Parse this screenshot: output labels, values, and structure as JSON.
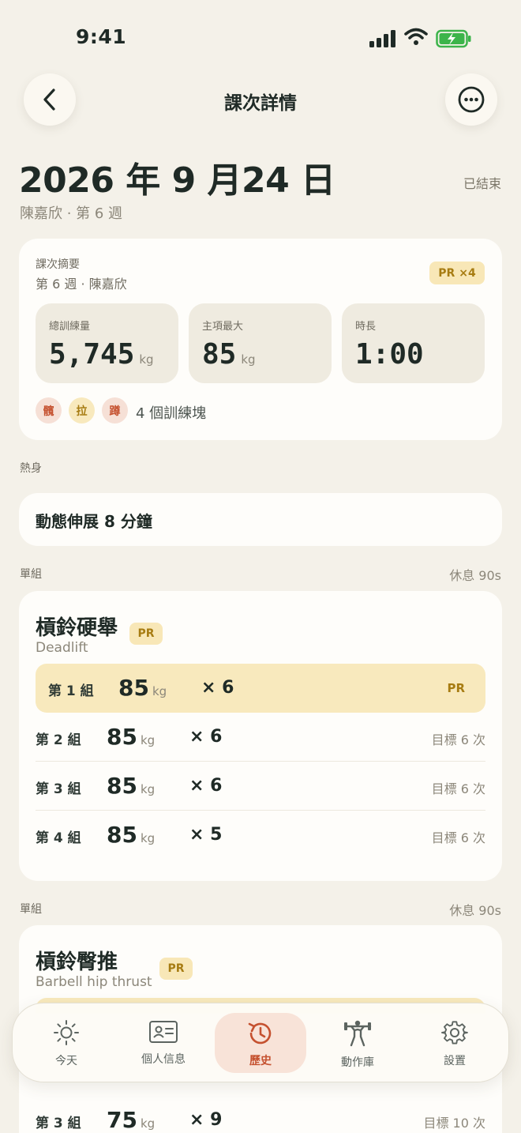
{
  "status_bar": {
    "time": "9:41"
  },
  "header": {
    "title": "課次詳情"
  },
  "session": {
    "date": "2026 年 9 月24 日",
    "status": "已結束",
    "subtitle": "陳嘉欣 · 第 6 週"
  },
  "summary": {
    "label": "課次摘要",
    "sub": "第 6 週 · 陳嘉欣",
    "pr_badge": "PR ×4",
    "stats": [
      {
        "label": "總訓練量",
        "value": "5,745",
        "unit": "kg"
      },
      {
        "label": "主項最大",
        "value": "85",
        "unit": "kg"
      },
      {
        "label": "時長",
        "value": "1:00",
        "unit": ""
      }
    ],
    "tags": [
      {
        "text": "髖",
        "bg": "#f6e0d6",
        "fg": "#c5512f"
      },
      {
        "text": "拉",
        "bg": "#f8e9bd",
        "fg": "#a77c12"
      },
      {
        "text": "蹲",
        "bg": "#f6e0d6",
        "fg": "#c5512f"
      }
    ],
    "tags_text": "4 個訓練塊"
  },
  "warmup": {
    "label": "熱身",
    "text": "動態伸展 8 分鐘"
  },
  "blocks": [
    {
      "type_label": "單組",
      "rest": "休息 90s",
      "exercise_name": "槓鈴硬舉",
      "exercise_en": "Deadlift",
      "pr_badge": "PR",
      "sets": [
        {
          "label": "第 1 組",
          "weight": "85",
          "unit": "kg",
          "reps": "× 6",
          "target": "",
          "pr": "PR"
        },
        {
          "label": "第 2 組",
          "weight": "85",
          "unit": "kg",
          "reps": "× 6",
          "target": "目標 6 次",
          "pr": ""
        },
        {
          "label": "第 3 組",
          "weight": "85",
          "unit": "kg",
          "reps": "× 6",
          "target": "目標 6 次",
          "pr": ""
        },
        {
          "label": "第 4 組",
          "weight": "85",
          "unit": "kg",
          "reps": "× 5",
          "target": "目標 6 次",
          "pr": ""
        }
      ]
    },
    {
      "type_label": "單組",
      "rest": "休息 90s",
      "exercise_name": "槓鈴臀推",
      "exercise_en": "Barbell hip thrust",
      "pr_badge": "PR",
      "sets": [
        {
          "label": "第 3 組",
          "weight": "75",
          "unit": "kg",
          "reps": "× 9",
          "target": "目標 10 次",
          "pr": ""
        }
      ]
    }
  ],
  "tab_bar": {
    "tabs": [
      {
        "label": "今天",
        "icon": "sun-icon"
      },
      {
        "label": "個人信息",
        "icon": "id-card-icon"
      },
      {
        "label": "歷史",
        "icon": "history-icon"
      },
      {
        "label": "動作庫",
        "icon": "weightlifter-icon"
      },
      {
        "label": "設置",
        "icon": "gear-icon"
      }
    ],
    "active": "歷史"
  },
  "colors": {
    "background": "#f4f1e9",
    "card": "#fefdfa",
    "accent": "#c5512f",
    "pr_gold": "#a77c12",
    "pr_bg": "#f8e9bd"
  }
}
